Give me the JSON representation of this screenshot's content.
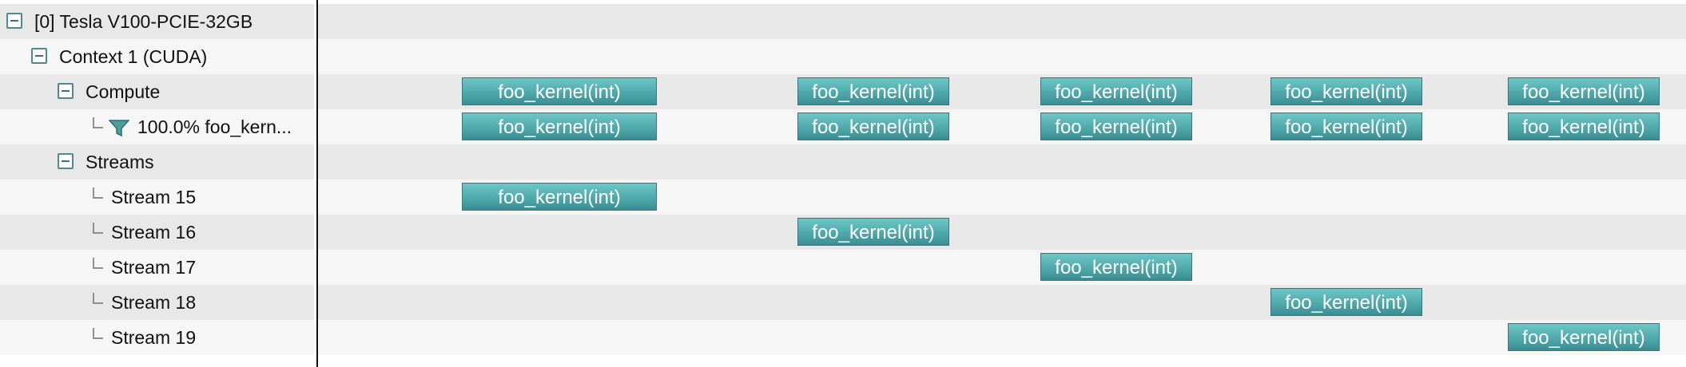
{
  "colors": {
    "row_shaded": "#e8e8e8",
    "row_light": "#f6f6f6",
    "kernel_fill": "#4fa9ab",
    "toggle_border": "#4e8a8f",
    "divider": "#111111"
  },
  "rows": [
    {
      "label": "[0] Tesla V100-PCIE-32GB",
      "kind": "toggle",
      "level": 0
    },
    {
      "label": "Context 1 (CUDA)",
      "kind": "toggle",
      "level": 1
    },
    {
      "label": "Compute",
      "kind": "toggle",
      "level": 2
    },
    {
      "label": "100.0% foo_kern...",
      "kind": "filter",
      "level": 3,
      "icon": "filter-icon"
    },
    {
      "label": "Streams",
      "kind": "toggle",
      "level": 2
    },
    {
      "label": "Stream 15",
      "kind": "leaf",
      "level": 3
    },
    {
      "label": "Stream 16",
      "kind": "leaf",
      "level": 3
    },
    {
      "label": "Stream 17",
      "kind": "leaf",
      "level": 3
    },
    {
      "label": "Stream 18",
      "kind": "leaf",
      "level": 3
    },
    {
      "label": "Stream 19",
      "kind": "leaf",
      "level": 3
    }
  ],
  "kernel_label": "foo_kernel(int)",
  "kernel_rows": [
    {
      "row": 2,
      "kernels": [
        0,
        1,
        2,
        3,
        4
      ]
    },
    {
      "row": 3,
      "kernels": [
        0,
        1,
        2,
        3,
        4
      ]
    },
    {
      "row": 5,
      "kernels": [
        0
      ]
    },
    {
      "row": 6,
      "kernels": [
        1
      ]
    },
    {
      "row": 7,
      "kernels": [
        2
      ]
    },
    {
      "row": 8,
      "kernels": [
        3
      ]
    },
    {
      "row": 9,
      "kernels": [
        4
      ]
    }
  ]
}
